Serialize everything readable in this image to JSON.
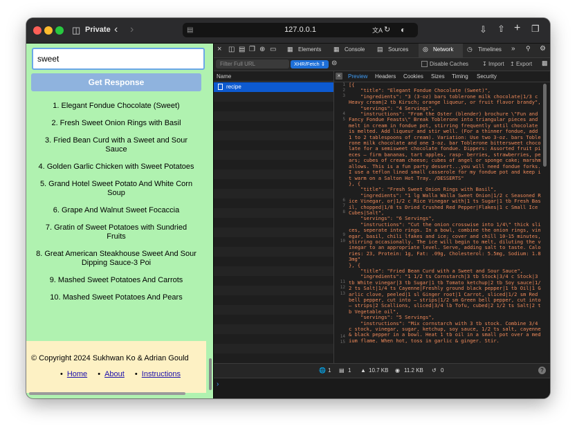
{
  "browser": {
    "private_label": "Private",
    "url": "127.0.0.1",
    "icons": [
      "sidebar-icon",
      "back-icon",
      "forward-icon",
      "page-icon",
      "translate-icon",
      "reload-icon",
      "shield-icon",
      "download-icon",
      "share-icon",
      "new-tab-icon",
      "tabs-overview-icon"
    ]
  },
  "app": {
    "search_value": "sweet",
    "get_button": "Get Response",
    "results": [
      "1. Elegant Fondue Chocolate (Sweet)",
      "2. Fresh Sweet Onion Rings with Basil",
      "3. Fried Bean Curd with a Sweet and Sour Sauce",
      "4. Golden Garlic Chicken with Sweet Potatoes",
      "5. Grand Hotel Sweet Potato And White Corn Soup",
      "6. Grape And Walnut Sweet Focaccia",
      "7. Gratin of Sweet Potatoes with Sundried Fruits",
      "8. Great American Steakhouse Sweet And Sour Dipping Sauce-3 Poi",
      "9. Mashed Sweet Potatoes And Carrots",
      "10. Mashed Sweet Potatoes And Pears"
    ],
    "footer": {
      "copyright": "© Copyright 2024 Sukhwan Ko & Adrian Gould",
      "links": [
        "Home",
        "About",
        "Instructions"
      ]
    }
  },
  "devtools": {
    "tabs": [
      "Elements",
      "Console",
      "Sources",
      "Network",
      "Timelines"
    ],
    "active_tab": "Network",
    "filter_placeholder": "Filter Full URL",
    "type_filter": "XHR/Fetch",
    "disable_caches": "Disable Caches",
    "import": "Import",
    "export": "Export",
    "name_header": "Name",
    "request": "recipe",
    "preview_tabs": [
      "Preview",
      "Headers",
      "Cookies",
      "Sizes",
      "Timing",
      "Security"
    ],
    "line_numbers": [
      "1",
      "2",
      "3",
      "4",
      "5",
      "6",
      "7",
      "8",
      "9",
      "10",
      "11",
      "12",
      "13",
      "14",
      "15"
    ],
    "json_preview": "[{\n    \"title\": \"Elegant Fondue Chocolate (Sweet)\",\n    \"ingredients\": \"3 (3-oz) bars toblerone milk chocolate|1/3 c Heavy cream|2 tb Kirsch; orange liqueur, or fruit flavor brandy\",\n    \"servings\": \"4 Servings\",\n    \"instructions\": \"From the Oster (blender) brochure \\\"Fun and Fancy Fondue Feasts\\\" Break Toblerone into triangular pieces and melt in cream in fondue pot, stirring frequently until chocolate is melted. Add liqueur and stir well. (For a thinner fondue, add 1 to 2 tablespoons of cream). Variation: Use two 3-oz. bars Toblerone milk chocolate and one 3-oz. bar Toblerone bittersweet chocolate for a semisweet chocolate fondue. Dippers: Assorted fruit pieces — firm bananas, tart apples, rasp- berries, strawberries, pears; cubes of cream cheese; cubes of angel or sponge cake; marshmallows. This is a fun party dessert...you will need fondue forks. I use a teflon lined small casserole for my fondue pot and keep it warm on a Salton Hot Tray. /DESSERTS\"\n}, {\n    \"title\": \"Fresh Sweet Onion Rings with Basil\",\n    \"ingredients\": \"1 lg Walla Walla Sweet Onion|1/2 c Seasoned Rice Vinegar, or|1/2 c Rice Vinegar with|1 ts Sugar|1 tb Fresh Basil, chopped|1/8 ts Dried Crushed Red Pepper|Flakes|1 c Small Ice Cubes|Salt\",\n    \"servings\": \"6 Servings\",\n    \"instructions\": \"Cut the onion crosswise into 1/4\\\" thick slices, seperate into rings. In a bowl, combine the onion rings, vinegar, basil, chili lfakes and ice; cover and chill 10-15 minutes, stirring occasionally. The ice will begin to melt, diluting the vinegar to an appropriate level. Serve, adding salt to taste. Calories: 23, Protein: 1g, Fat: .09g, Cholesterol: 5.5mg, Sodium: 1.83mg\"\n}, {\n    \"title\": \"Fried Bean Curd with a Sweet and Sour Sauce\",\n    \"ingredients\": \"1 1/2 ts Cornstarch|3 tb Stock|3/4 c Stock|3 tb White vinegar|3 tb Sugar|1 tb Tomato ketchup|2 tb Soy sauce|1/2 ts Salt|1/4 ts Cayenne|Freshly ground black pepper|1 tb Oil|1 Garlic clove, peeled|1 sl Ginger root|1 Carrot, sliced|1/2 sm Red bell pepper, cut into — strips|1/2 sm Green bell pepper, cut into — strips|2 Scallions, sliced|3/4 lb Tofu, cubed|2 1/2 ts Salt|2 tb Vegetable oil\",\n    \"servings\": \"5 Servings\",\n    \"instructions\": \"Mix cornstarch with 3 tb stock. Combine 3/4 c stock, vinegar, sugar, ketchup, soy sauce, 1/2 ts salt, cayenne & black pepper in a bowl. Heat 1 tb oil in a small pot over a medium flame. When hot, toss in garlic & ginger. Stir.",
    "status": {
      "requests": "1",
      "resources": "1",
      "transferred": "10.7 KB",
      "size": "11.2 KB",
      "time": "0"
    },
    "help": "?"
  }
}
